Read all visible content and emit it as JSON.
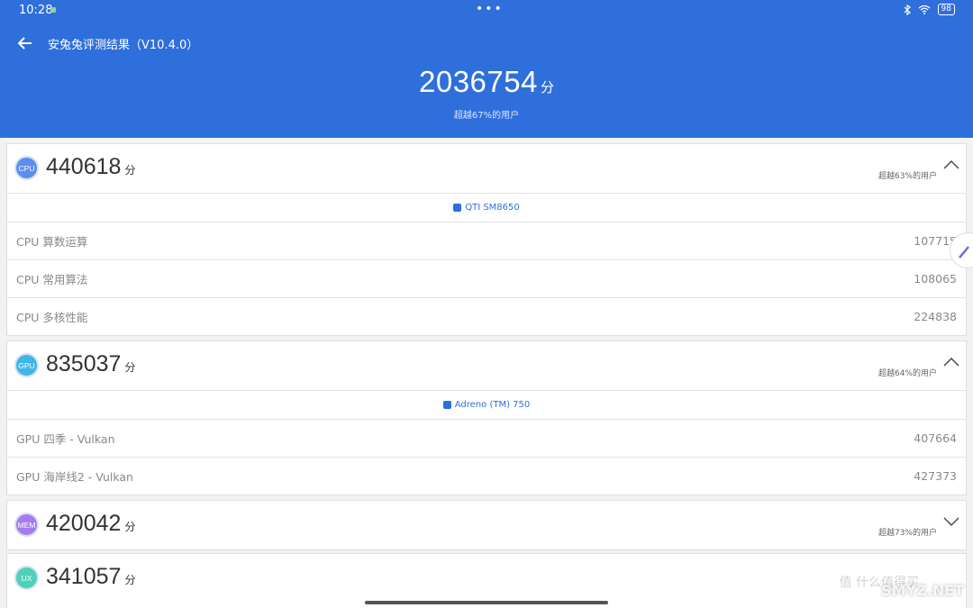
{
  "status": {
    "time": "10:28",
    "battery": "98"
  },
  "header": {
    "title": "安兔兔评测结果（V10.4.0）",
    "total_score": "2036754",
    "unit": "分",
    "percentile": "超越67%的用户"
  },
  "cpu": {
    "badge": "CPU",
    "score": "440618",
    "unit": "分",
    "percentile": "超越63%的用户",
    "chip": "QTI SM8650",
    "rows": [
      {
        "label": "CPU 算数运算",
        "value": "107715"
      },
      {
        "label": "CPU 常用算法",
        "value": "108065"
      },
      {
        "label": "CPU 多核性能",
        "value": "224838"
      }
    ]
  },
  "gpu": {
    "badge": "GPU",
    "score": "835037",
    "unit": "分",
    "percentile": "超越64%的用户",
    "chip": "Adreno (TM) 750",
    "rows": [
      {
        "label": "GPU 四季 - Vulkan",
        "value": "407664"
      },
      {
        "label": "GPU 海岸线2 - Vulkan",
        "value": "427373"
      }
    ]
  },
  "mem": {
    "badge": "MEM",
    "score": "420042",
    "unit": "分",
    "percentile": "超越73%的用户"
  },
  "ux": {
    "badge": "UX",
    "score": "341057",
    "unit": "分"
  },
  "watermark": {
    "text": "SMYZ.NET",
    "cn": "值 什么值得买"
  },
  "colors": {
    "header": "#2f6fdc",
    "cpu": "#5b8ef0",
    "gpu": "#3fb6e8",
    "mem": "#a57cf0",
    "ux": "#4fd1b8"
  }
}
